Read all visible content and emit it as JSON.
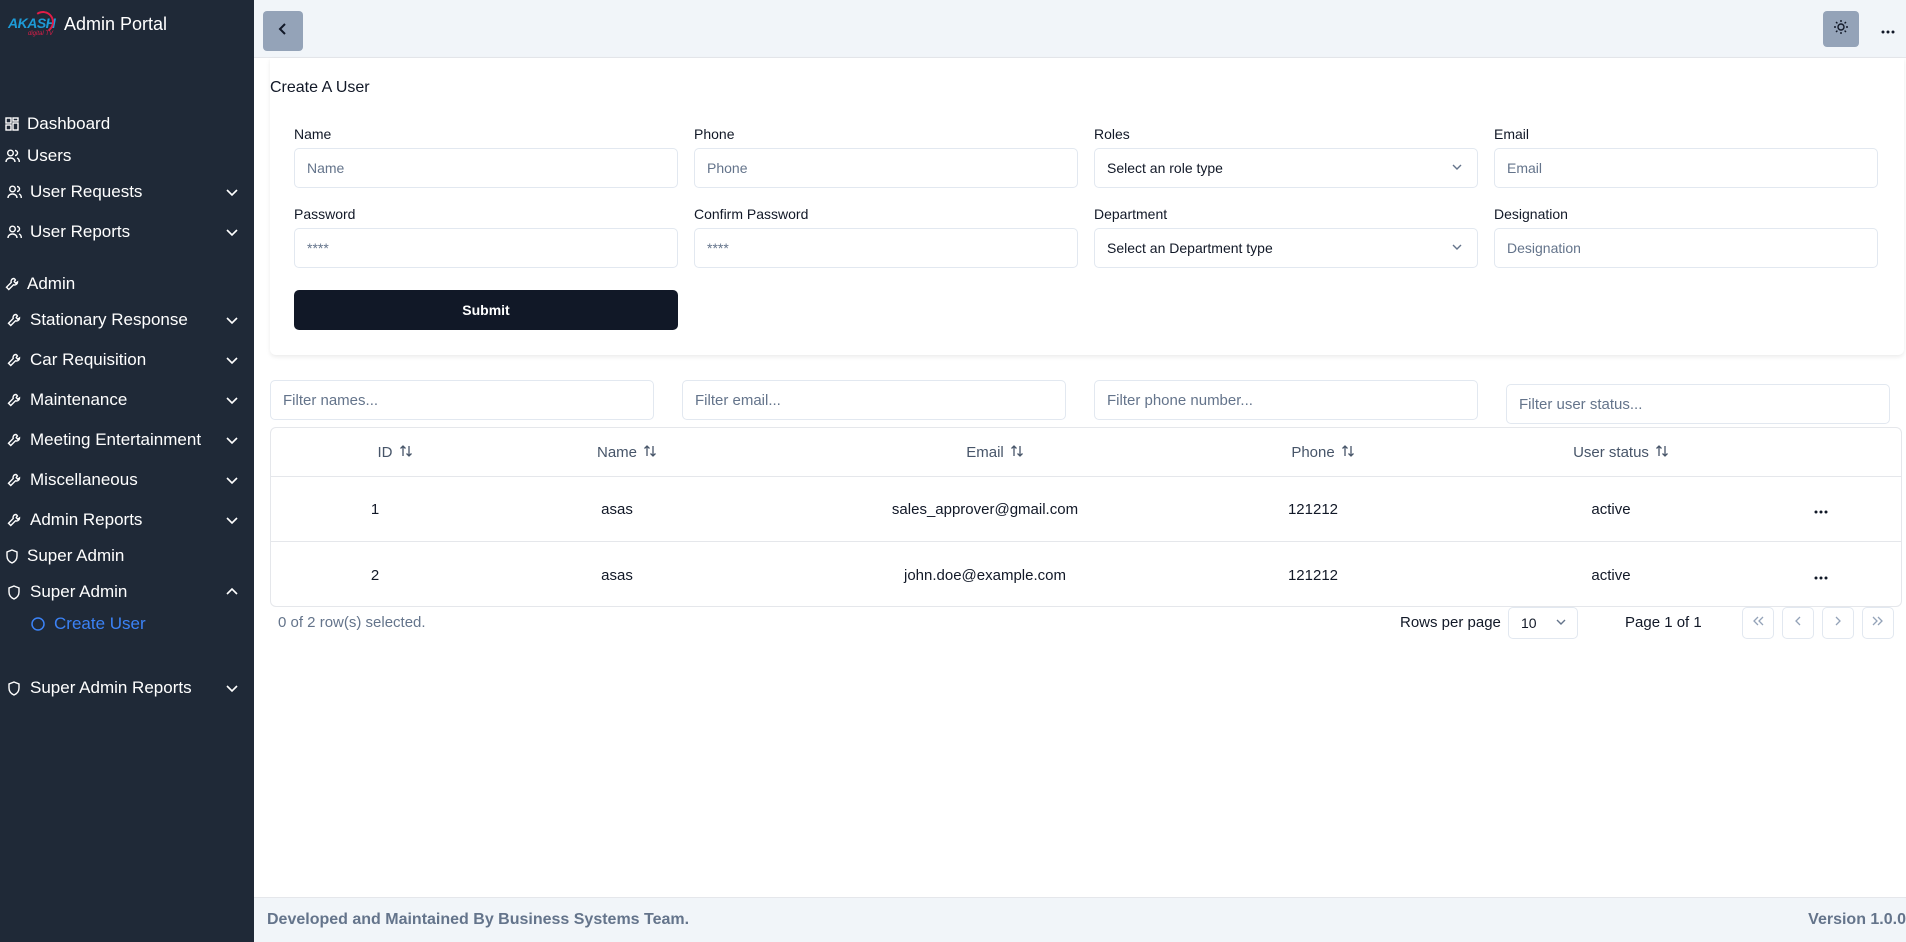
{
  "app": {
    "logo_text": "AKASH",
    "logo_sub": "digital TV",
    "title": "Admin Portal"
  },
  "sidebar": {
    "items": [
      {
        "label": "Dashboard"
      },
      {
        "label": "Users"
      },
      {
        "label": "User Requests"
      },
      {
        "label": "User Reports"
      },
      {
        "label": "Admin"
      },
      {
        "label": "Stationary Response"
      },
      {
        "label": "Car Requisition"
      },
      {
        "label": "Maintenance"
      },
      {
        "label": "Meeting Entertainment"
      },
      {
        "label": "Miscellaneous"
      },
      {
        "label": "Admin Reports"
      },
      {
        "label": "Super Admin"
      },
      {
        "label": "Super Admin"
      },
      {
        "label": "Create User"
      },
      {
        "label": "Super Admin Reports"
      }
    ]
  },
  "form": {
    "title": "Create A User",
    "name_label": "Name",
    "name_placeholder": "Name",
    "phone_label": "Phone",
    "phone_placeholder": "Phone",
    "roles_label": "Roles",
    "roles_value": "Select an role type",
    "email_label": "Email",
    "email_placeholder": "Email",
    "password_label": "Password",
    "password_placeholder": "****",
    "confirm_label": "Confirm Password",
    "confirm_placeholder": "****",
    "department_label": "Department",
    "department_value": "Select an Department type",
    "designation_label": "Designation",
    "designation_placeholder": "Designation",
    "submit_label": "Submit"
  },
  "filters": {
    "names": "Filter names...",
    "email": "Filter email...",
    "phone": "Filter phone number...",
    "status": "Filter user status..."
  },
  "table": {
    "headers": {
      "id": "ID",
      "name": "Name",
      "email": "Email",
      "phone": "Phone",
      "status": "User status"
    },
    "rows": [
      {
        "id": "1",
        "name": "asas",
        "email": "sales_approver@gmail.com",
        "phone": "121212",
        "status": "active"
      },
      {
        "id": "2",
        "name": "asas",
        "email": "john.doe@example.com",
        "phone": "121212",
        "status": "active"
      }
    ],
    "selection_info": "0 of 2 row(s) selected.",
    "rows_per_page_label": "Rows per page",
    "rows_per_page_value": "10",
    "page_info": "Page 1 of 1"
  },
  "footer": {
    "credits": "Developed and Maintained By Business Systems Team.",
    "version": "Version 1.0.0"
  },
  "colors": {
    "sidebar_bg": "#1f2937",
    "active_link": "#3b82f6",
    "submit_bg": "#111827"
  }
}
